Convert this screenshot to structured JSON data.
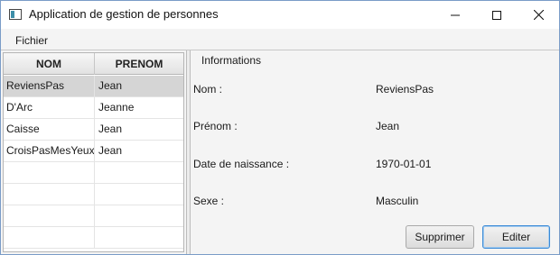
{
  "window": {
    "title": "Application de gestion de personnes",
    "app_icon": "app-window-icon",
    "controls": [
      "minimize-icon",
      "maximize-icon",
      "close-icon"
    ]
  },
  "menubar": {
    "items": [
      {
        "label": "Fichier"
      }
    ]
  },
  "table": {
    "columns": [
      "NOM",
      "PRENOM"
    ],
    "rows": [
      {
        "nom": "ReviensPas",
        "prenom": "Jean"
      },
      {
        "nom": "D'Arc",
        "prenom": "Jeanne"
      },
      {
        "nom": "Caisse",
        "prenom": "Jean"
      },
      {
        "nom": "CroisPasMesYeux",
        "prenom": "Jean"
      }
    ],
    "selected_row": 0
  },
  "details": {
    "section_title": "Informations",
    "fields": [
      {
        "label": "Nom :",
        "value": "ReviensPas"
      },
      {
        "label": "Prénom :",
        "value": "Jean"
      },
      {
        "label": "Date de naissance :",
        "value": "1970-01-01"
      },
      {
        "label": "Sexe :",
        "value": "Masculin"
      }
    ],
    "buttons": {
      "delete_label": "Supprimer",
      "edit_label": "Editer"
    }
  },
  "colors": {
    "window_border": "#7a9cc7",
    "selected_row": "#d5d5d5",
    "default_button_border": "#3b8ad6"
  }
}
